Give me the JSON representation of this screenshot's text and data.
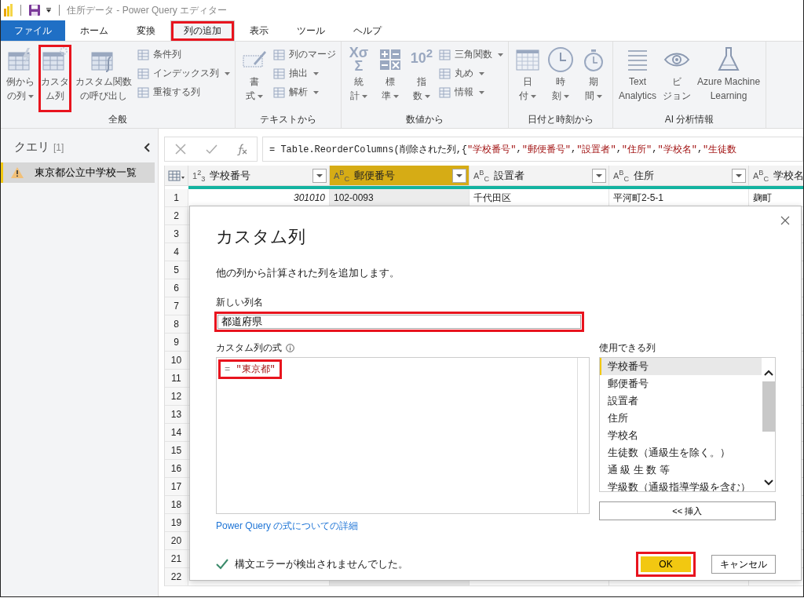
{
  "window": {
    "title": "住所データ - Power Query エディター"
  },
  "tabs": [
    {
      "label": "ファイル",
      "kind": "file",
      "selected": false,
      "annotated": false
    },
    {
      "label": "ホーム",
      "kind": "tab",
      "selected": false,
      "annotated": false
    },
    {
      "label": "変換",
      "kind": "tab",
      "selected": false,
      "annotated": false
    },
    {
      "label": "列の追加",
      "kind": "tab",
      "selected": true,
      "annotated": true
    },
    {
      "label": "表示",
      "kind": "tab",
      "selected": false,
      "annotated": false
    },
    {
      "label": "ツール",
      "kind": "tab",
      "selected": false,
      "annotated": false
    },
    {
      "label": "ヘルプ",
      "kind": "tab",
      "selected": false,
      "annotated": false
    }
  ],
  "ribbon": [
    {
      "label": "全般",
      "large": [
        {
          "lines": [
            "例から",
            "の列"
          ],
          "dropdown": true,
          "annotated": false
        },
        {
          "lines": [
            "カスタ",
            "ム列"
          ],
          "dropdown": false,
          "annotated": true
        },
        {
          "lines": [
            "カスタム関数",
            "の呼び出し"
          ],
          "dropdown": false,
          "annotated": false
        }
      ],
      "small": [
        {
          "label": "条件列",
          "dropdown": false
        },
        {
          "label": "インデックス列",
          "dropdown": true
        },
        {
          "label": "重複する列",
          "dropdown": false
        }
      ]
    },
    {
      "label": "テキストから",
      "large": [
        {
          "lines": [
            "書",
            "式"
          ],
          "dropdown": true,
          "annotated": false
        }
      ],
      "small": [
        {
          "label": "列のマージ",
          "dropdown": false
        },
        {
          "label": "抽出",
          "dropdown": true
        },
        {
          "label": "解析",
          "dropdown": true
        }
      ]
    },
    {
      "label": "数値から",
      "large": [
        {
          "lines": [
            "統",
            "計"
          ],
          "dropdown": true,
          "annotated": false,
          "icon_text": "XσΣ"
        },
        {
          "lines": [
            "標",
            "準"
          ],
          "dropdown": true,
          "annotated": false
        },
        {
          "lines": [
            "指",
            "数"
          ],
          "dropdown": true,
          "annotated": false,
          "icon_text": "10$^{2}$"
        }
      ],
      "small": [
        {
          "label": "三角関数",
          "dropdown": true
        },
        {
          "label": "丸め",
          "dropdown": true
        },
        {
          "label": "情報",
          "dropdown": true
        }
      ]
    },
    {
      "label": "日付と時刻から",
      "large": [
        {
          "lines": [
            "日",
            "付"
          ],
          "dropdown": true,
          "annotated": false
        },
        {
          "lines": [
            "時",
            "刻"
          ],
          "dropdown": true,
          "annotated": false
        },
        {
          "lines": [
            "期",
            "間"
          ],
          "dropdown": true,
          "annotated": false
        }
      ]
    },
    {
      "label": "AI 分析情報",
      "large": [
        {
          "lines": [
            "Text",
            "Analytics"
          ],
          "dropdown": false,
          "annotated": false
        },
        {
          "lines": [
            "ビ",
            "ジョン"
          ],
          "dropdown": false,
          "annotated": false
        },
        {
          "lines": [
            "Azure Machine",
            "Learning"
          ],
          "dropdown": false,
          "annotated": false
        }
      ]
    }
  ],
  "queries": {
    "title": "クエリ",
    "count": "[1]",
    "items": [
      {
        "name": "東京都公立中学校一覧",
        "selected": true,
        "warning": true
      }
    ]
  },
  "formula_bar": {
    "segments": [
      {
        "kind": "plain",
        "text": "= Table.ReorderColumns(削除された列,{"
      },
      {
        "kind": "string",
        "text": "\"学校番号\""
      },
      {
        "kind": "plain",
        "text": ", "
      },
      {
        "kind": "string",
        "text": "\"郵便番号\""
      },
      {
        "kind": "plain",
        "text": ", "
      },
      {
        "kind": "string",
        "text": "\"設置者\""
      },
      {
        "kind": "plain",
        "text": ", "
      },
      {
        "kind": "string",
        "text": "\"住所\""
      },
      {
        "kind": "plain",
        "text": ", "
      },
      {
        "kind": "string",
        "text": "\"学校名\""
      },
      {
        "kind": "plain",
        "text": ", "
      },
      {
        "kind": "string",
        "text": "\"生徒数"
      }
    ]
  },
  "table": {
    "columns": [
      {
        "type_label": "1$^{2}$$_{3}$",
        "name": "学校番号",
        "selected": false
      },
      {
        "type_label": "A$^{B}$$_{C}$",
        "name": "郵便番号",
        "selected": true
      },
      {
        "type_label": "A$^{B}$$_{C}$",
        "name": "設置者",
        "selected": false
      },
      {
        "type_label": "A$^{B}$$_{C}$",
        "name": "住所",
        "selected": false
      },
      {
        "type_label": "A$^{B}$$_{C}$",
        "name": "学校名",
        "selected": false
      }
    ],
    "rows": [
      {
        "number": "1",
        "cells": [
          {
            "text": "301010",
            "kind": "number"
          },
          {
            "text": "102-0093",
            "kind": "text"
          },
          {
            "text": "千代田区",
            "kind": "text"
          },
          {
            "text": "平河町2-5-1",
            "kind": "text"
          },
          {
            "text": "麹町",
            "kind": "text"
          }
        ]
      },
      {
        "number": "2"
      },
      {
        "number": "3"
      },
      {
        "number": "4"
      },
      {
        "number": "5"
      },
      {
        "number": "6"
      },
      {
        "number": "7"
      },
      {
        "number": "8"
      },
      {
        "number": "9"
      },
      {
        "number": "10"
      },
      {
        "number": "11"
      },
      {
        "number": "12"
      },
      {
        "number": "13"
      },
      {
        "number": "14"
      },
      {
        "number": "15"
      },
      {
        "number": "16"
      },
      {
        "number": "17"
      },
      {
        "number": "18"
      },
      {
        "number": "19"
      },
      {
        "number": "20"
      },
      {
        "number": "21"
      },
      {
        "number": "22"
      }
    ]
  },
  "dialog": {
    "title": "カスタム列",
    "description": "他の列から計算された列を追加します。",
    "name_label": "新しい列名",
    "name_value": "都道府県",
    "name_annotated": true,
    "formula_label": "カスタム列の式",
    "formula_annotated": true,
    "formula": [
      {
        "kind": "operator",
        "text": "= "
      },
      {
        "kind": "string",
        "text": "\"東京都\""
      }
    ],
    "columns_label": "使用できる列",
    "columns": [
      {
        "name": "学校番号",
        "selected": true
      },
      {
        "name": "郵便番号",
        "selected": false
      },
      {
        "name": "設置者",
        "selected": false
      },
      {
        "name": "住所",
        "selected": false
      },
      {
        "name": "学校名",
        "selected": false
      },
      {
        "name": "生徒数（通級生を除く。）",
        "selected": false
      },
      {
        "name": "通 級 生 数 等",
        "selected": false
      },
      {
        "name": "学級数（通級指導学級を含む）",
        "selected": false
      }
    ],
    "insert_button": "<< 挿入",
    "help_link": "Power Query の式についての詳細",
    "status": "構文エラーが検出されませんでした。",
    "status_ok": true,
    "ok_button": "OK",
    "ok_annotated": true,
    "cancel_button": "キャンセル"
  }
}
